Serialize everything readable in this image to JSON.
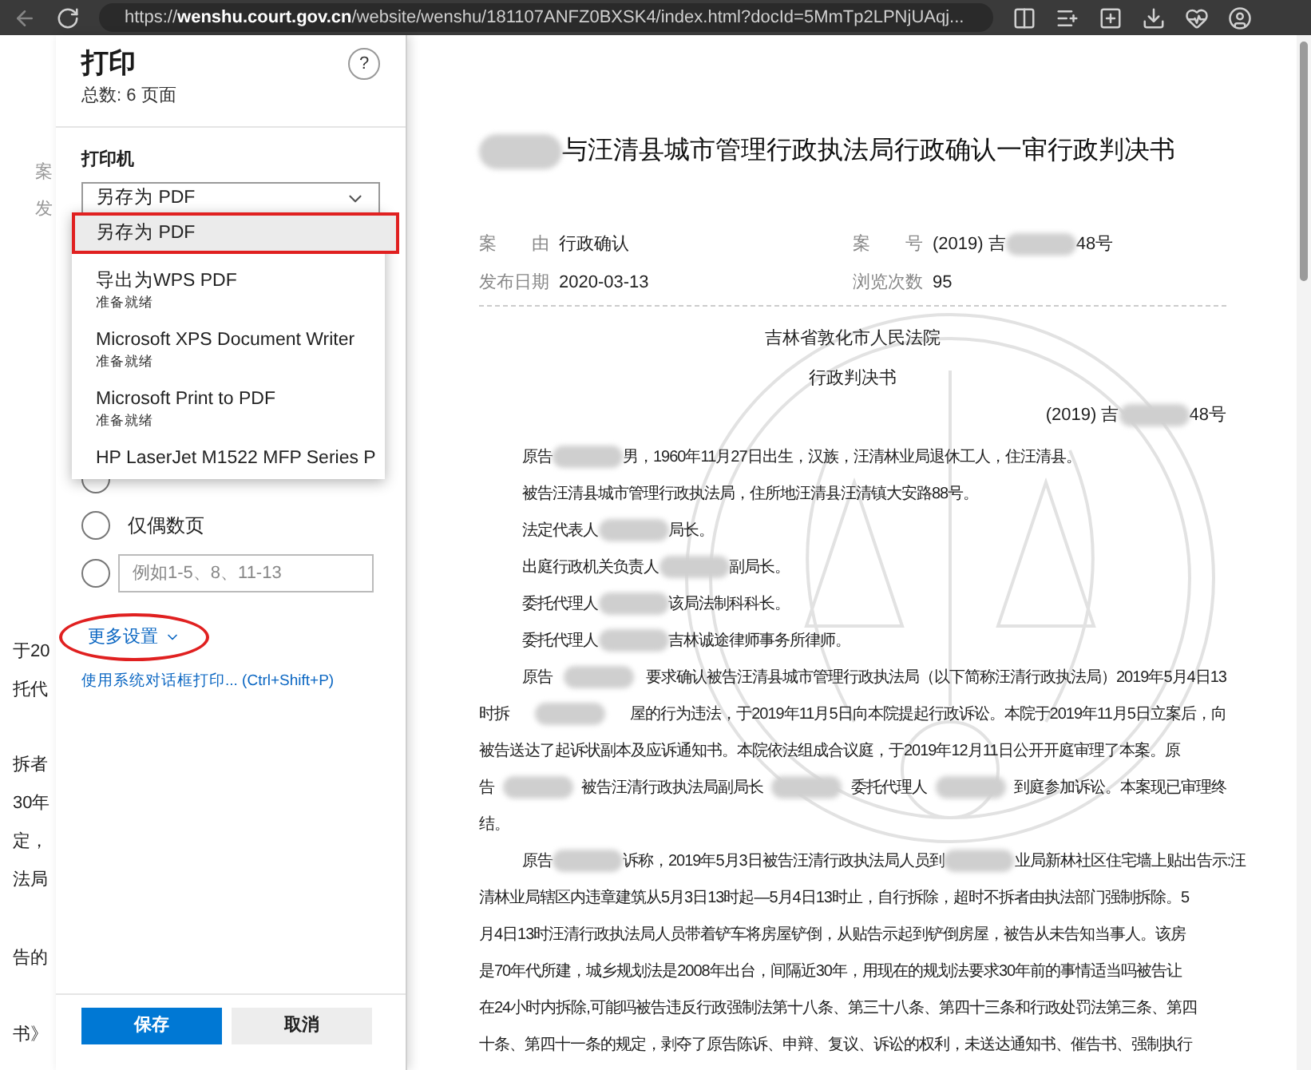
{
  "browser": {
    "url": "https://**wenshu.court.gov.cn**/website/wenshu/181107ANFZ0BXSK4/index.html?docId=5MmTp2LPNjUAqj..."
  },
  "background_page": {
    "fragments": [
      {
        "kind": "label",
        "text": "案"
      },
      {
        "kind": "label",
        "text": "发"
      },
      {
        "kind": "text",
        "text": "于20"
      },
      {
        "kind": "text",
        "text": "托代"
      },
      {
        "kind": "text",
        "text": "拆者"
      },
      {
        "kind": "text",
        "text": "30年"
      },
      {
        "kind": "text",
        "text": "定，"
      },
      {
        "kind": "text",
        "text": "法局"
      },
      {
        "kind": "text",
        "text": "告的"
      },
      {
        "kind": "text",
        "text": "书》"
      }
    ]
  },
  "print_panel": {
    "title": "打印",
    "page_count": "总数: 6 页面",
    "help": "?",
    "printer_label": "打印机",
    "printer_value": "另存为 PDF",
    "printers": [
      {
        "name": "另存为 PDF",
        "selected": true,
        "boxed": true
      },
      {
        "name": "导出为WPS PDF",
        "status": "准备就绪",
        "selected": false,
        "boxed": false
      },
      {
        "name": "Microsoft XPS Document Writer",
        "status": "准备就绪",
        "selected": false,
        "boxed": false
      },
      {
        "name": "Microsoft Print to PDF",
        "status": "准备就绪",
        "selected": false,
        "boxed": false
      },
      {
        "name": "HP LaserJet M1522 MFP Series P",
        "selected": false,
        "boxed": false
      }
    ],
    "page_options": [
      {
        "kind": "radio",
        "selected": false
      },
      {
        "kind": "radio",
        "label": "仅偶数页",
        "selected": false
      },
      {
        "kind": "range",
        "placeholder": "例如1-5、8、11-13",
        "selected": false
      }
    ],
    "more_settings": {
      "label": "更多设置",
      "circled": true
    },
    "system_dialog_link": "使用系统对话框打印... (Ctrl+Shift+P)",
    "buttons": [
      {
        "label": "保存",
        "kind": "primary"
      },
      {
        "label": "取消",
        "kind": "secondary"
      }
    ]
  },
  "document": {
    "title": [
      {
        "kind": "redaction"
      },
      {
        "kind": "text",
        "text": "与汪清县城市管理行政执法局行政确认一审行政判决书"
      }
    ],
    "meta": [
      {
        "label": "案　　由",
        "value": [
          {
            "kind": "text",
            "text": "行政确认"
          }
        ]
      },
      {
        "label": "案　　号",
        "value": [
          {
            "kind": "text",
            "text": "(2019) 吉"
          },
          {
            "kind": "redaction"
          },
          {
            "kind": "text",
            "text": "48号"
          }
        ]
      },
      {
        "label": "发布日期",
        "value": [
          {
            "kind": "text",
            "text": "2020-03-13"
          }
        ]
      },
      {
        "label": "浏览次数",
        "value": [
          {
            "kind": "text",
            "text": "95"
          }
        ]
      }
    ],
    "court": "吉林省敦化市人民法院",
    "doc_type": "行政判决书",
    "case_number": [
      {
        "kind": "text",
        "text": "(2019) 吉"
      },
      {
        "kind": "redaction"
      },
      {
        "kind": "text",
        "text": "48号"
      }
    ],
    "paragraphs": [
      {
        "lines": [
          [
            {
              "kind": "text",
              "text": "原告"
            },
            {
              "kind": "redaction"
            },
            {
              "kind": "text",
              "text": "男，1960年11月27日出生，汉族，汪清林业局退休工人，住汪清县。"
            }
          ]
        ]
      },
      {
        "lines": [
          [
            {
              "kind": "text",
              "text": "被告汪清县城市管理行政执法局，住所地汪清县汪清镇大安路88号。"
            }
          ]
        ]
      },
      {
        "lines": [
          [
            {
              "kind": "text",
              "text": "法定代表人"
            },
            {
              "kind": "redaction"
            },
            {
              "kind": "text",
              "text": "局长。"
            }
          ]
        ]
      },
      {
        "lines": [
          [
            {
              "kind": "text",
              "text": "出庭行政机关负责人"
            },
            {
              "kind": "redaction"
            },
            {
              "kind": "text",
              "text": "副局长。"
            }
          ]
        ]
      },
      {
        "lines": [
          [
            {
              "kind": "text",
              "text": "委托代理人"
            },
            {
              "kind": "redaction"
            },
            {
              "kind": "text",
              "text": "该局法制科科长。"
            }
          ]
        ]
      },
      {
        "lines": [
          [
            {
              "kind": "text",
              "text": "委托代理人"
            },
            {
              "kind": "redaction"
            },
            {
              "kind": "text",
              "text": "吉林诚途律师事务所律师。"
            }
          ]
        ]
      },
      {
        "lines": [
          [
            {
              "kind": "text",
              "text": "原告"
            },
            {
              "kind": "redaction"
            },
            {
              "kind": "text",
              "text": "要求确认被告汪清县城市管理行政执法局（以下简称汪清行政执法局）2019年5月4日13"
            }
          ],
          [
            {
              "kind": "text",
              "text": "时拆"
            },
            {
              "kind": "redaction"
            },
            {
              "kind": "text",
              "text": "屋的行为违法，于2019年11月5日向本院提起行政诉讼。本院于2019年11月5日立案后，向"
            }
          ],
          [
            {
              "kind": "text",
              "text": "被告送达了起诉状副本及应诉通知书。本院依法组成合议庭，于2019年12月11日公开开庭审理了本案。原"
            }
          ],
          [
            {
              "kind": "text",
              "text": "告"
            },
            {
              "kind": "redaction"
            },
            {
              "kind": "text",
              "text": "被告汪清行政执法局副局长"
            },
            {
              "kind": "redaction"
            },
            {
              "kind": "text",
              "text": "委托代理人"
            },
            {
              "kind": "redaction"
            },
            {
              "kind": "text",
              "text": "到庭参加诉讼。本案现已审理终"
            }
          ],
          [
            {
              "kind": "text",
              "text": "结。"
            }
          ]
        ]
      },
      {
        "lines": [
          [
            {
              "kind": "text",
              "text": "原告"
            },
            {
              "kind": "redaction"
            },
            {
              "kind": "text",
              "text": "诉称，2019年5月3日被告汪清行政执法局人员到"
            },
            {
              "kind": "redaction"
            },
            {
              "kind": "text",
              "text": "业局新林社区住宅墙上贴出告示:汪"
            }
          ],
          [
            {
              "kind": "text",
              "text": "清林业局辖区内违章建筑从5月3日13时起—5月4日13时止，自行拆除，超时不拆者由执法部门强制拆除。5"
            }
          ],
          [
            {
              "kind": "text",
              "text": "月4日13时汪清行政执法局人员带着铲车将房屋铲倒，从贴告示起到铲倒房屋，被告从未告知当事人。该房"
            }
          ],
          [
            {
              "kind": "text",
              "text": "是70年代所建，城乡规划法是2008年出台，间隔近30年，用现在的规划法要求30年前的事情适当吗被告让"
            }
          ],
          [
            {
              "kind": "text",
              "text": "在24小时内拆除,可能吗被告违反行政强制法第十八条、第三十八条、第四十三条和行政处罚法第三条、第四"
            }
          ],
          [
            {
              "kind": "text",
              "text": "十条、第四十一条的规定，剥夺了原告陈诉、申辩、复议、诉讼的权利，未送达通知书、催告书、强制执行"
            }
          ]
        ]
      }
    ]
  }
}
